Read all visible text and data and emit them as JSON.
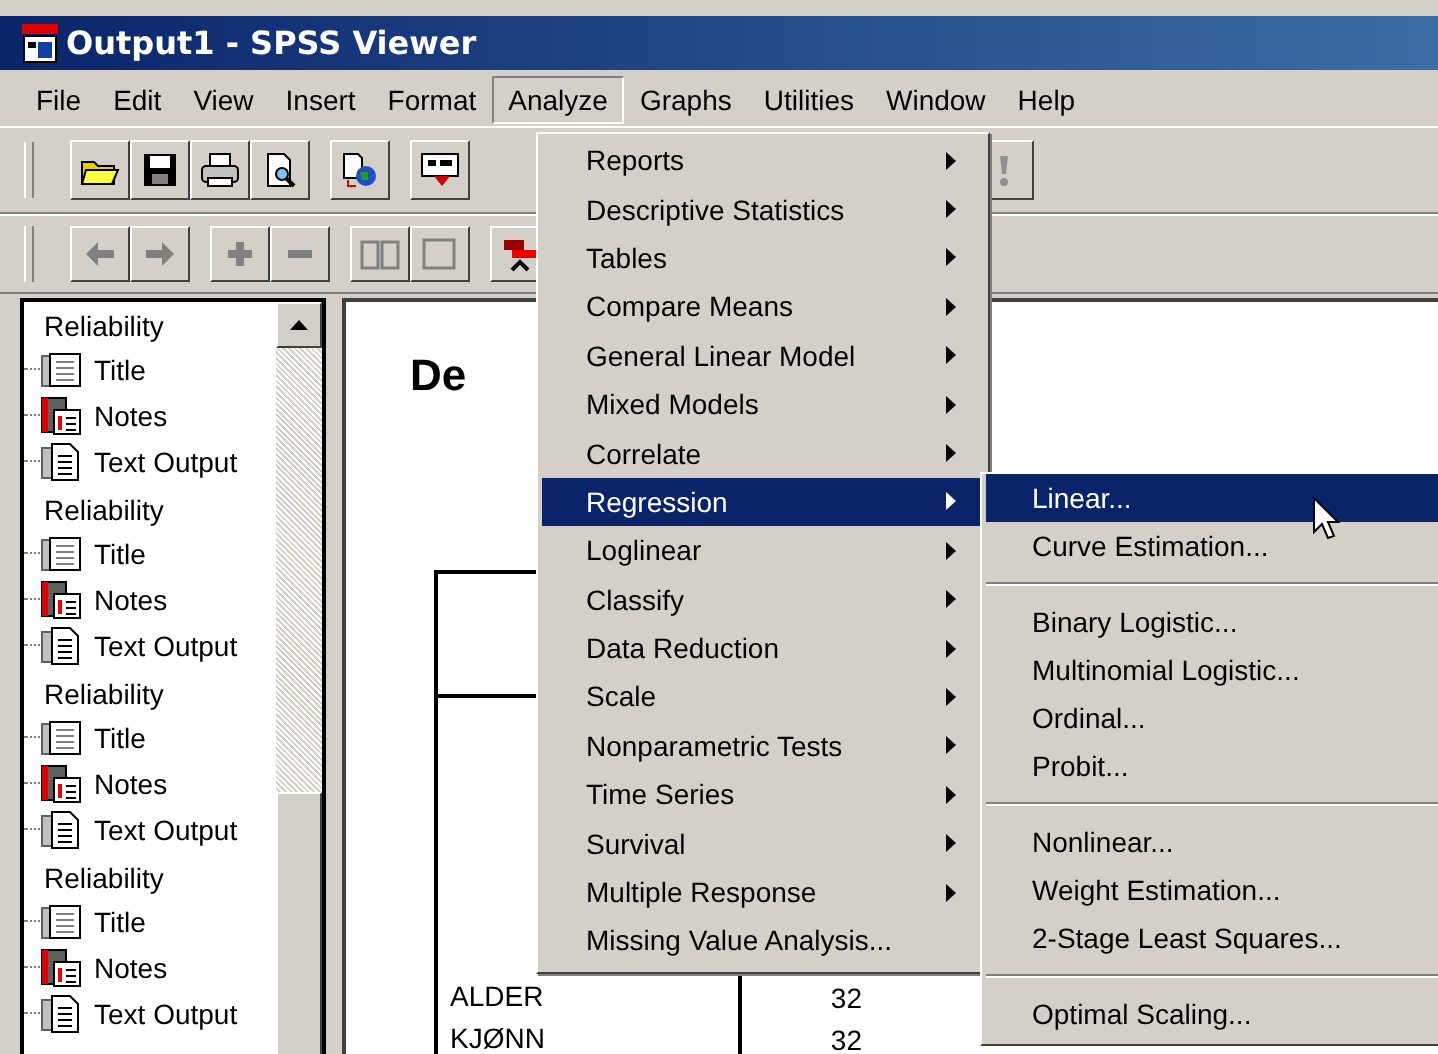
{
  "window": {
    "title": "Output1 - SPSS Viewer"
  },
  "menu_bar": [
    {
      "label": "File",
      "selected": false
    },
    {
      "label": "Edit",
      "selected": false
    },
    {
      "label": "View",
      "selected": false
    },
    {
      "label": "Insert",
      "selected": false
    },
    {
      "label": "Format",
      "selected": false
    },
    {
      "label": "Analyze",
      "selected": true
    },
    {
      "label": "Graphs",
      "selected": false
    },
    {
      "label": "Utilities",
      "selected": false
    },
    {
      "label": "Window",
      "selected": false
    },
    {
      "label": "Help",
      "selected": false
    }
  ],
  "outline": [
    {
      "label": "Reliability",
      "children": [
        {
          "label": "Title",
          "kind": "title"
        },
        {
          "label": "Notes",
          "kind": "notes"
        },
        {
          "label": "Text Output",
          "kind": "text"
        }
      ]
    },
    {
      "label": "Reliability",
      "children": [
        {
          "label": "Title",
          "kind": "title"
        },
        {
          "label": "Notes",
          "kind": "notes"
        },
        {
          "label": "Text Output",
          "kind": "text"
        }
      ]
    },
    {
      "label": "Reliability",
      "children": [
        {
          "label": "Title",
          "kind": "title"
        },
        {
          "label": "Notes",
          "kind": "notes"
        },
        {
          "label": "Text Output",
          "kind": "text"
        }
      ]
    },
    {
      "label": "Reliability",
      "children": [
        {
          "label": "Title",
          "kind": "title"
        },
        {
          "label": "Notes",
          "kind": "notes"
        },
        {
          "label": "Text Output",
          "kind": "text"
        }
      ]
    }
  ],
  "document": {
    "heading": "De",
    "table": {
      "rows": [
        {
          "column_1": "ALDER",
          "column_2": "32"
        },
        {
          "column_1": "KJØNN",
          "column_2": "32"
        }
      ]
    }
  },
  "analyze_menu": [
    {
      "label": "Reports",
      "submenu": true,
      "selected": false
    },
    {
      "label": "Descriptive Statistics",
      "submenu": true,
      "selected": false
    },
    {
      "label": "Tables",
      "submenu": true,
      "selected": false
    },
    {
      "label": "Compare Means",
      "submenu": true,
      "selected": false
    },
    {
      "label": "General Linear Model",
      "submenu": true,
      "selected": false
    },
    {
      "label": "Mixed Models",
      "submenu": true,
      "selected": false
    },
    {
      "label": "Correlate",
      "submenu": true,
      "selected": false
    },
    {
      "label": "Regression",
      "submenu": true,
      "selected": true
    },
    {
      "label": "Loglinear",
      "submenu": true,
      "selected": false
    },
    {
      "label": "Classify",
      "submenu": true,
      "selected": false
    },
    {
      "label": "Data Reduction",
      "submenu": true,
      "selected": false
    },
    {
      "label": "Scale",
      "submenu": true,
      "selected": false
    },
    {
      "label": "Nonparametric Tests",
      "submenu": true,
      "selected": false
    },
    {
      "label": "Time Series",
      "submenu": true,
      "selected": false
    },
    {
      "label": "Survival",
      "submenu": true,
      "selected": false
    },
    {
      "label": "Multiple Response",
      "submenu": true,
      "selected": false
    },
    {
      "label": "Missing Value Analysis...",
      "submenu": false,
      "selected": false
    }
  ],
  "regression_submenu": [
    {
      "label": "Linear...",
      "selected": true,
      "separator_before": false
    },
    {
      "label": "Curve Estimation...",
      "selected": false,
      "separator_before": false
    },
    {
      "label": "Binary Logistic...",
      "selected": false,
      "separator_before": true
    },
    {
      "label": "Multinomial Logistic...",
      "selected": false,
      "separator_before": false
    },
    {
      "label": "Ordinal...",
      "selected": false,
      "separator_before": false
    },
    {
      "label": "Probit...",
      "selected": false,
      "separator_before": false
    },
    {
      "label": "Nonlinear...",
      "selected": false,
      "separator_before": true
    },
    {
      "label": "Weight Estimation...",
      "selected": false,
      "separator_before": false
    },
    {
      "label": "2-Stage Least Squares...",
      "selected": false,
      "separator_before": false
    },
    {
      "label": "Optimal Scaling...",
      "selected": false,
      "separator_before": true
    }
  ]
}
